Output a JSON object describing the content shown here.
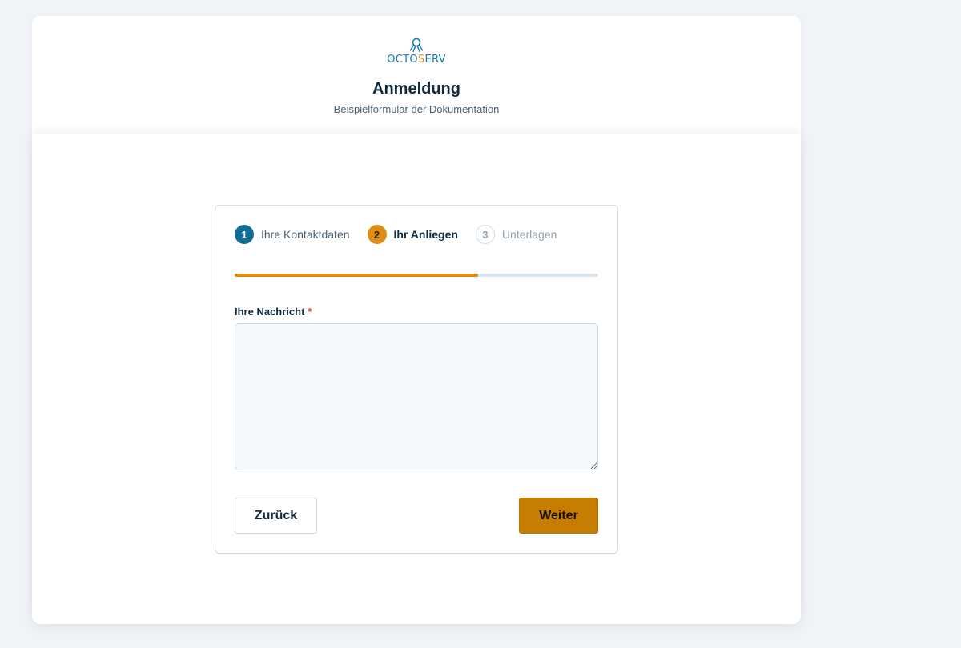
{
  "header": {
    "logo_text_left": "OCTO",
    "logo_text_accent": "S",
    "logo_text_right": "ERV",
    "title": "Anmeldung",
    "subtitle": "Beispielformular der Dokumentation"
  },
  "stepper": {
    "steps": [
      {
        "number": "1",
        "label": "Ihre Kontaktdaten",
        "state": "done"
      },
      {
        "number": "2",
        "label": "Ihr Anliegen",
        "state": "active"
      },
      {
        "number": "3",
        "label": "Unterlagen",
        "state": "todo"
      }
    ],
    "progress_fraction": 0.67
  },
  "form": {
    "message_label": "Ihre Nachricht",
    "required_marker": "*",
    "message_value": "",
    "back_label": "Zurück",
    "next_label": "Weiter"
  },
  "colors": {
    "primary": "#0f6d96",
    "accent": "#e08c10",
    "button_next": "#c77e00",
    "required": "#d63a2f"
  }
}
